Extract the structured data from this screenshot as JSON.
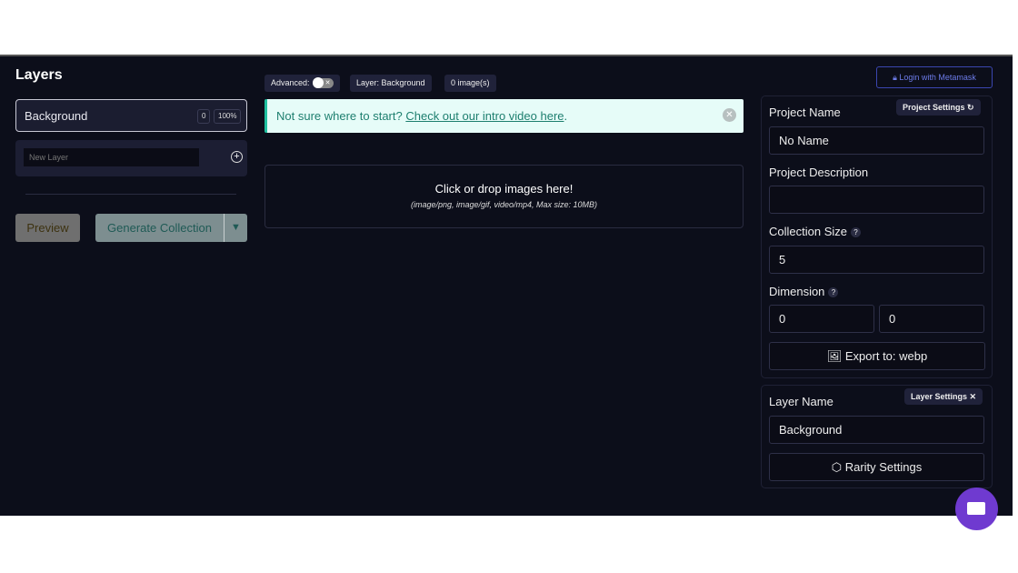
{
  "left": {
    "title": "Layers",
    "layer": {
      "name": "Background",
      "count": "0",
      "rarity": "100%"
    },
    "new_layer_placeholder": "New Layer",
    "preview": "Preview",
    "generate": "Generate Collection",
    "dropdown": "▼"
  },
  "toolbar": {
    "advanced": "Advanced:",
    "toggle_off": "✕",
    "layer": "Layer: Background",
    "images": "0 image(s)"
  },
  "notice": {
    "text": "Not sure where to start? ",
    "link": "Check out our intro video here",
    "end": "."
  },
  "dropzone": {
    "title": "Click or drop images here!",
    "subtitle": "(image/png, image/gif, video/mp4, Max size: 10MB)"
  },
  "login": "Login with Metamask",
  "project": {
    "badge": "Project Settings",
    "name_label": "Project Name",
    "name": "No Name",
    "desc_label": "Project Description",
    "desc": "",
    "size_label": "Collection Size",
    "size": "5",
    "dim_label": "Dimension",
    "width": "0",
    "height": "0",
    "export": "Export to: webp"
  },
  "layer_settings": {
    "badge": "Layer Settings",
    "name_label": "Layer Name",
    "name": "Background",
    "rarity": "Rarity Settings"
  },
  "colors": {
    "bg": "#0c0e1a",
    "accent": "#20c0a0",
    "chat": "#6f3ad0",
    "login": "#6c7be8"
  }
}
